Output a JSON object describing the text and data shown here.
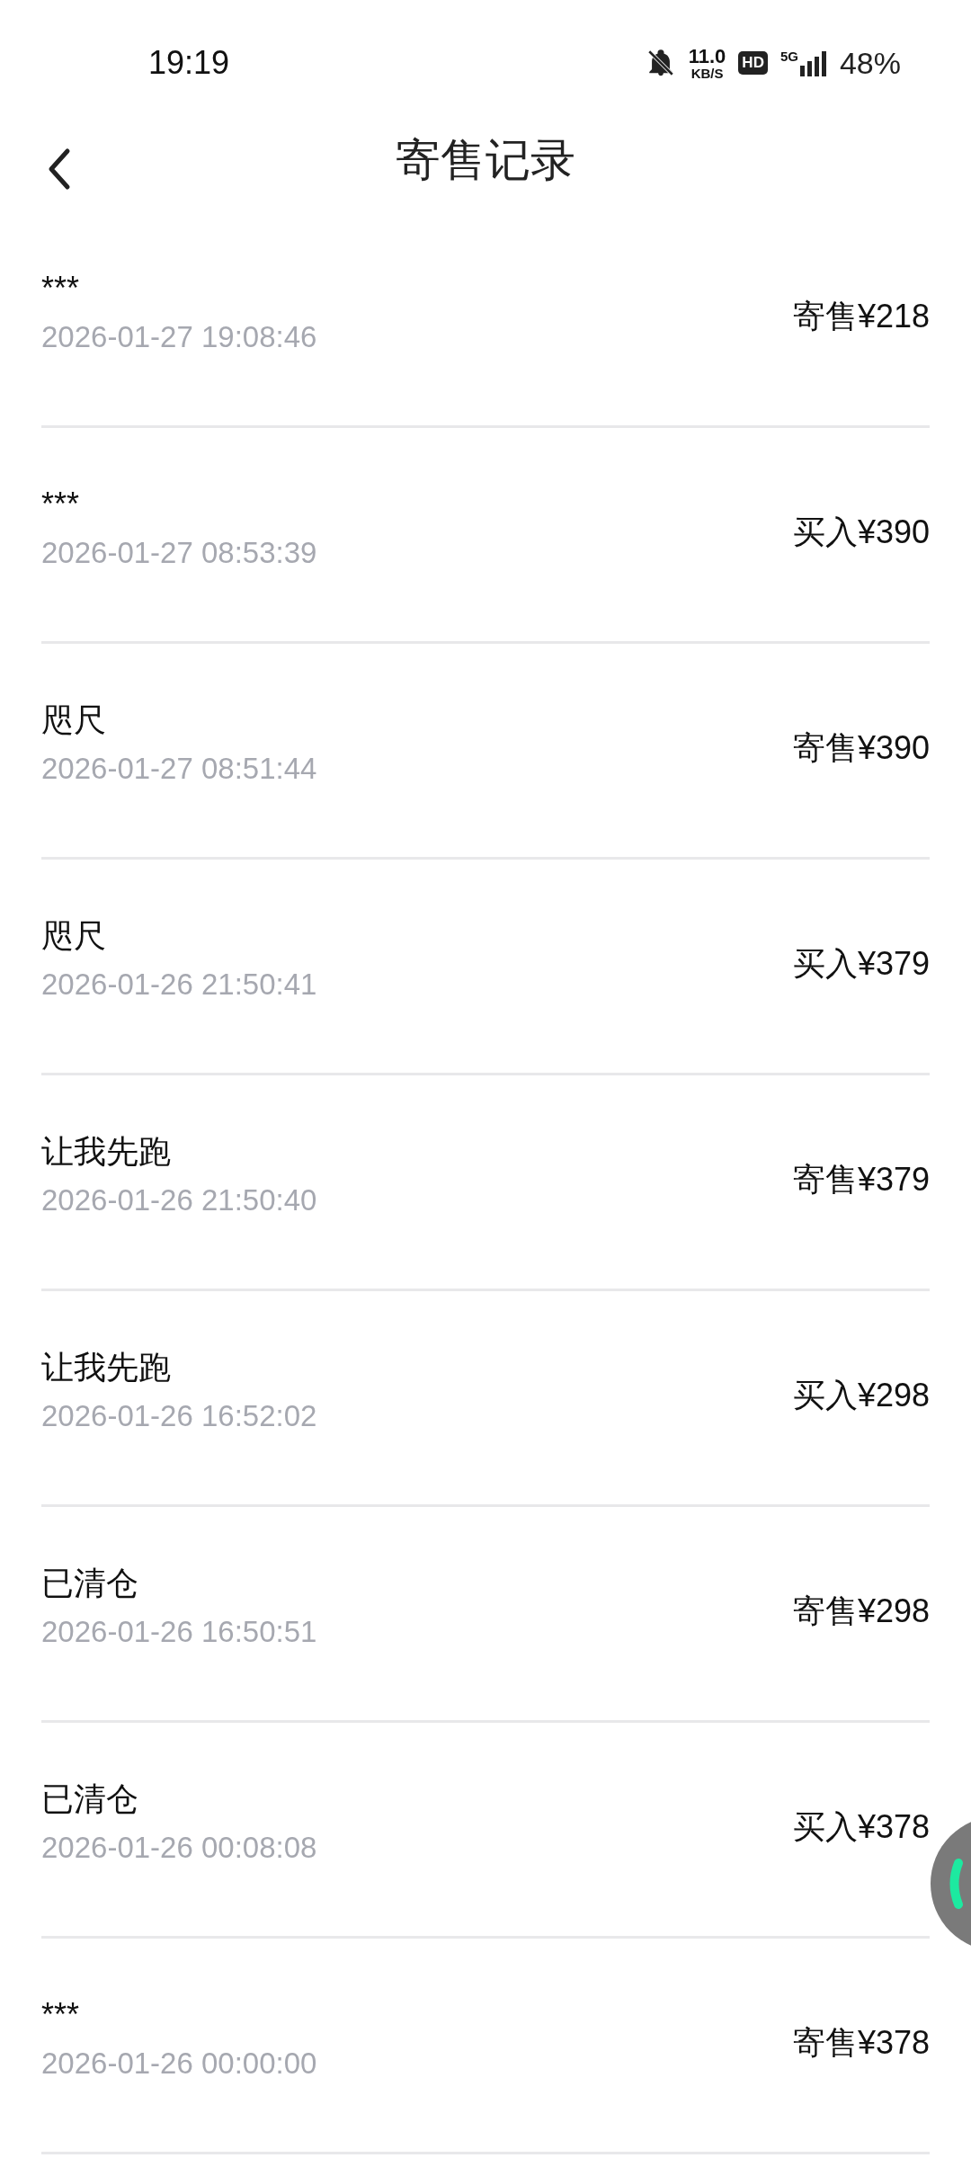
{
  "status_bar": {
    "time": "19:19",
    "speed": "11.0",
    "speed_unit": "KB/S",
    "hd": "HD",
    "network": "5G",
    "battery": "48%"
  },
  "header": {
    "title": "寄售记录"
  },
  "records": [
    {
      "name": "***",
      "time": "2026-01-27 19:08:46",
      "amount": "寄售¥218"
    },
    {
      "name": "***",
      "time": "2026-01-27 08:53:39",
      "amount": "买入¥390"
    },
    {
      "name": "咫尺",
      "time": "2026-01-27 08:51:44",
      "amount": "寄售¥390"
    },
    {
      "name": "咫尺",
      "time": "2026-01-26 21:50:41",
      "amount": "买入¥379"
    },
    {
      "name": "让我先跑",
      "time": "2026-01-26 21:50:40",
      "amount": "寄售¥379"
    },
    {
      "name": "让我先跑",
      "time": "2026-01-26 16:52:02",
      "amount": "买入¥298"
    },
    {
      "name": "已清仓",
      "time": "2026-01-26 16:50:51",
      "amount": "寄售¥298"
    },
    {
      "name": "已清仓",
      "time": "2026-01-26 00:08:08",
      "amount": "买入¥378"
    },
    {
      "name": "***",
      "time": "2026-01-26 00:00:00",
      "amount": "寄售¥378"
    }
  ]
}
